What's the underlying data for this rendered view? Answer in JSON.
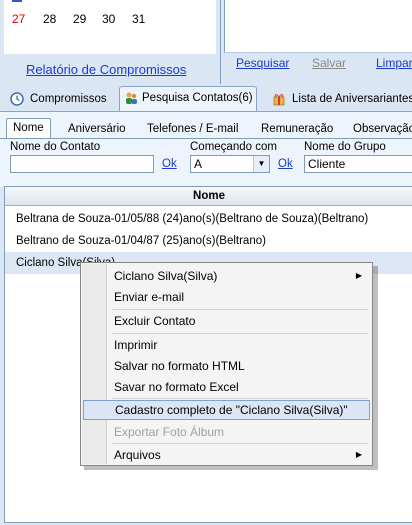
{
  "calendar": {
    "days": [
      "27",
      "28",
      "29",
      "30",
      "31"
    ]
  },
  "report_link": "Relatório de Compromissos",
  "actions": {
    "search": "Pesquisar",
    "save": "Salvar",
    "clear": "Limpar"
  },
  "main_tabs": [
    {
      "label": "Compromissos",
      "icon": "clock-icon"
    },
    {
      "label": "Pesquisa Contatos(6)",
      "icon": "contacts-icon"
    },
    {
      "label": "Lista de Aniversariantes",
      "icon": "gift-icon"
    }
  ],
  "sub_tabs": [
    "Nome",
    "Aniversário",
    "Telefones / E-mail",
    "Remuneração",
    "Observação"
  ],
  "filters": {
    "contact_name_label": "Nome do Contato",
    "contact_name_value": "",
    "starts_with_label": "Começando com",
    "starts_with_value": "A",
    "group_name_label": "Nome do Grupo",
    "group_name_value": "Cliente",
    "ok": "Ok"
  },
  "grid": {
    "header": "Nome",
    "rows": [
      "Beltrana de Souza-01/05/88  (24)ano(s)(Beltrano de Souza)(Beltrano)",
      "Beltrano de Souza-01/04/87  (25)ano(s)(Beltrano)",
      "Ciclano Silva(Silva)"
    ]
  },
  "context_menu": {
    "items": [
      {
        "label": "Ciclano Silva(Silva)",
        "submenu": true
      },
      {
        "label": "Enviar e-mail"
      },
      {
        "label": "Excluir Contato"
      },
      {
        "label": "Imprimir"
      },
      {
        "label": "Salvar no formato HTML"
      },
      {
        "label": "Savar no formato Excel"
      },
      {
        "label": "Cadastro completo de \"Ciclano Silva(Silva)\"",
        "highlighted": true
      },
      {
        "label": "Exportar Foto Álbum",
        "disabled": true
      },
      {
        "label": "Arquivos",
        "submenu": true
      }
    ]
  },
  "colors": {
    "link": "#1c3cc8",
    "sunday": "#d40000",
    "background": "#dbe6f4",
    "menu_highlight": "#dbe5f4"
  }
}
